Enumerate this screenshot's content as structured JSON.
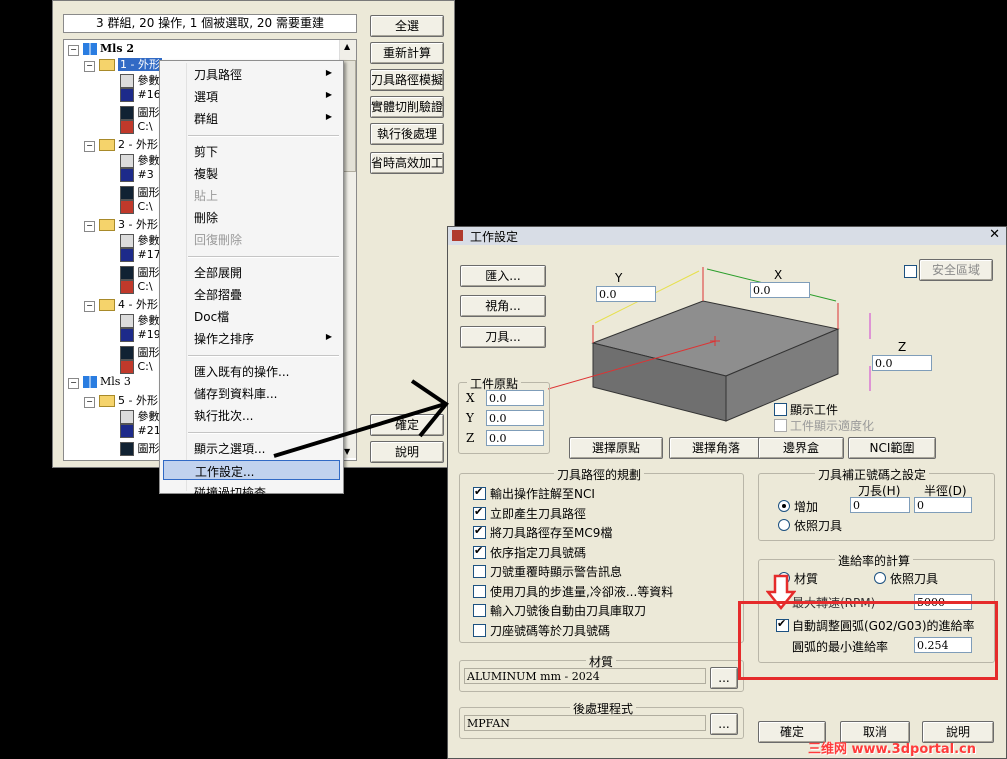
{
  "ops_window": {
    "status": "3 群組, 20 操作, 1 個被選取, 20 需要重建",
    "buttons": [
      "全選",
      "重新計算",
      "刀具路徑模擬",
      "實體切削驗證",
      "執行後處理",
      "省時高效加工"
    ],
    "ok": "確定",
    "help": "說明",
    "tree": {
      "group1": "Mls 2",
      "group2": "Mls 3",
      "ops": [
        {
          "name": "1 - 外形"
        },
        {
          "name": "2 - 外形"
        },
        {
          "name": "3 - 外形"
        },
        {
          "name": "4 - 外形"
        },
        {
          "name": "5 - 外形"
        }
      ],
      "child_param": "參數",
      "child_path": "C:\\",
      "child_graphic": "圖形",
      "tool_nums": [
        "#16",
        "#3",
        "#17",
        "#19",
        "#21"
      ]
    }
  },
  "context_menu": {
    "items": [
      {
        "label": "刀具路徑",
        "submenu": true,
        "disabled": false
      },
      {
        "label": "選項",
        "submenu": true,
        "disabled": false
      },
      {
        "label": "群組",
        "submenu": true,
        "disabled": false
      },
      {
        "sep": true
      },
      {
        "label": "剪下",
        "disabled": false
      },
      {
        "label": "複製",
        "disabled": false
      },
      {
        "label": "貼上",
        "disabled": true
      },
      {
        "label": "刪除",
        "disabled": false
      },
      {
        "label": "回復刪除",
        "disabled": true
      },
      {
        "sep": true
      },
      {
        "label": "全部展開",
        "disabled": false
      },
      {
        "label": "全部摺疊",
        "disabled": false
      },
      {
        "label": "Doc檔",
        "disabled": false
      },
      {
        "label": "操作之排序",
        "submenu": true,
        "disabled": false
      },
      {
        "sep": true
      },
      {
        "label": "匯入既有的操作...",
        "disabled": false
      },
      {
        "label": "儲存到資料庫...",
        "disabled": false
      },
      {
        "label": "執行批次...",
        "disabled": false
      },
      {
        "sep": true
      },
      {
        "label": "顯示之選項...",
        "disabled": false
      },
      {
        "label": "工作設定...",
        "disabled": false,
        "hover": true
      },
      {
        "label": "碰撞過切檢查...",
        "disabled": false
      }
    ]
  },
  "job_setup": {
    "title": "工作設定",
    "buttons_left": [
      "匯入...",
      "視角...",
      "刀具..."
    ],
    "safety_label": "安全區域",
    "dims": {
      "y_label": "Y",
      "y_value": "0.0",
      "x_label": "X",
      "x_value": "0.0",
      "z_label": "Z",
      "z_value": "0.0"
    },
    "origin": {
      "title": "工件原點",
      "rows": [
        {
          "label": "X",
          "value": "0.0"
        },
        {
          "label": "Y",
          "value": "0.0"
        },
        {
          "label": "Z",
          "value": "0.0"
        }
      ]
    },
    "show_workpiece": "顯示工件",
    "fit_workpiece": "工件顯示適度化",
    "action_buttons": [
      "選擇原點",
      "選擇角落",
      "邊界盒",
      "NCI範圍"
    ],
    "toolpath_config": {
      "title": "刀具路徑的規劃",
      "items": [
        {
          "label": "輸出操作註解至NCI",
          "checked": true
        },
        {
          "label": "立即產生刀具路徑",
          "checked": true
        },
        {
          "label": "將刀具路徑存至MC9檔",
          "checked": true
        },
        {
          "label": "依序指定刀具號碼",
          "checked": true
        },
        {
          "label": "刀號重覆時顯示警告訊息",
          "checked": false
        },
        {
          "label": "使用刀具的步進量,冷卻液...等資料",
          "checked": false
        },
        {
          "label": "輸入刀號後自動由刀具庫取刀",
          "checked": false
        },
        {
          "label": "刀座號碼等於刀具號碼",
          "checked": false
        }
      ]
    },
    "material": {
      "title": "材質",
      "value": "ALUMINUM mm - 2024",
      "btn": "..."
    },
    "post": {
      "title": "後處理程式",
      "value": "MPFAN",
      "btn": "..."
    },
    "tool_offset": {
      "title": "刀具補正號碼之設定",
      "len_label": "刀長(H)",
      "len_value": "0",
      "rad_label": "半徑(D)",
      "rad_value": "0",
      "opt_add": "增加",
      "opt_tool": "依照刀具"
    },
    "feed": {
      "title": "進給率的計算",
      "opt_material": "材質",
      "opt_tool": "依照刀具",
      "spindle_label": "最大轉速(RPM)",
      "spindle_value": "5000",
      "auto_arc": "自動調整圓弧(G02/G03)的進給率",
      "min_feed_label": "圓弧的最小進給率",
      "min_feed_value": "0.254"
    },
    "ok": "確定",
    "cancel": "取消",
    "help": "說明"
  },
  "watermark": "三维网 www.3dportal.cn",
  "colors": {
    "highlight_red": "#e52b2b",
    "select_blue": "#316ac5",
    "hover_blue": "#c1d2ee"
  }
}
